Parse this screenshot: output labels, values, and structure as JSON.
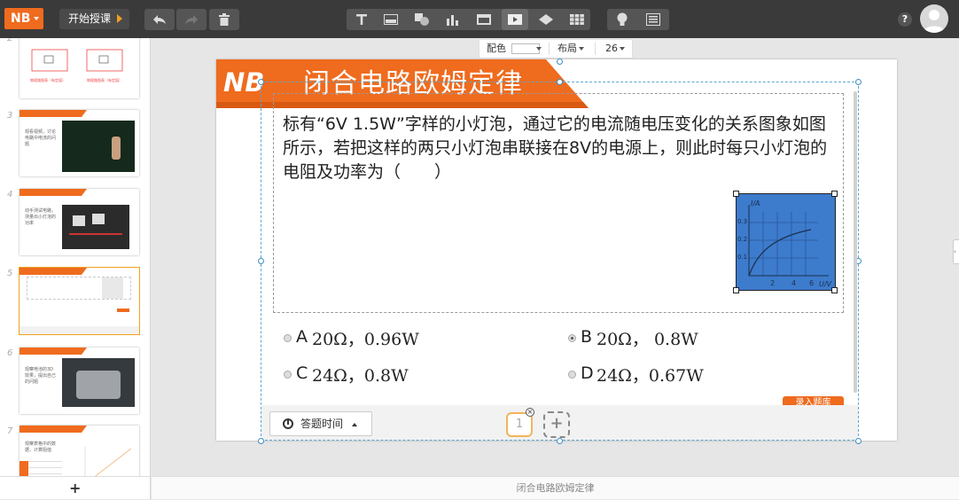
{
  "toolbar": {
    "logo": "NB",
    "start_label": "开始授课",
    "help": "?",
    "icons": [
      "undo-icon",
      "redo-icon",
      "trash-icon",
      "text-icon",
      "image-icon",
      "shape-icon",
      "chart-icon",
      "slide-layout-icon",
      "video-icon",
      "eraser-icon",
      "table-icon",
      "lightbulb-icon",
      "notes-icon"
    ]
  },
  "format_bar": {
    "color_label": "配色",
    "layout_label": "布局",
    "font_size": "26"
  },
  "sidebar": {
    "slides": [
      {
        "num": "2",
        "caption_a": "物理路图表（有定值）",
        "caption_b": "物理路图表（有定值）"
      },
      {
        "num": "3",
        "text": "观看视频，讨论电路中电流的问题"
      },
      {
        "num": "4",
        "text": "动手测试电路，测量出小灯泡的功率"
      },
      {
        "num": "5",
        "text": ""
      },
      {
        "num": "6",
        "text": "观察电池的3D效果，提出自己的问题"
      },
      {
        "num": "7",
        "text": "观察表格中的数据，计算阻值"
      }
    ],
    "add_label": "+"
  },
  "slide": {
    "title_logo": "NB",
    "title": "闭合电路欧姆定律",
    "question": "标有“6V 1.5W”字样的小灯泡，通过它的电流随电压变化的关系图象如图所示，若把这样的两只小灯泡串联接在8V的电源上，则此时每只小灯泡的电阻及功率为（　　）",
    "options": [
      {
        "letter": "A",
        "value": "20Ω，0.96W",
        "selected": false
      },
      {
        "letter": "B",
        "value": "20Ω， 0.8W",
        "selected": true
      },
      {
        "letter": "C",
        "value": "24Ω，0.8W",
        "selected": false
      },
      {
        "letter": "D",
        "value": "24Ω，0.67W",
        "selected": false
      }
    ],
    "graph": {
      "y_label": "I/A",
      "x_label": "U/V",
      "y_ticks": [
        "0.3",
        "0.2",
        "0.1"
      ],
      "x_ticks": [
        "2",
        "4",
        "6"
      ]
    },
    "time_label": "答题时间",
    "page_number": "1",
    "add_page": "+",
    "orange_tab": "录入题库"
  },
  "footer": {
    "title": "闭合电路欧姆定律"
  },
  "colors": {
    "accent": "#ef6b1e",
    "toolbar_bg": "#3a3a3a",
    "graph_bg": "#3d7bcc",
    "selection": "#5aa7cf"
  }
}
